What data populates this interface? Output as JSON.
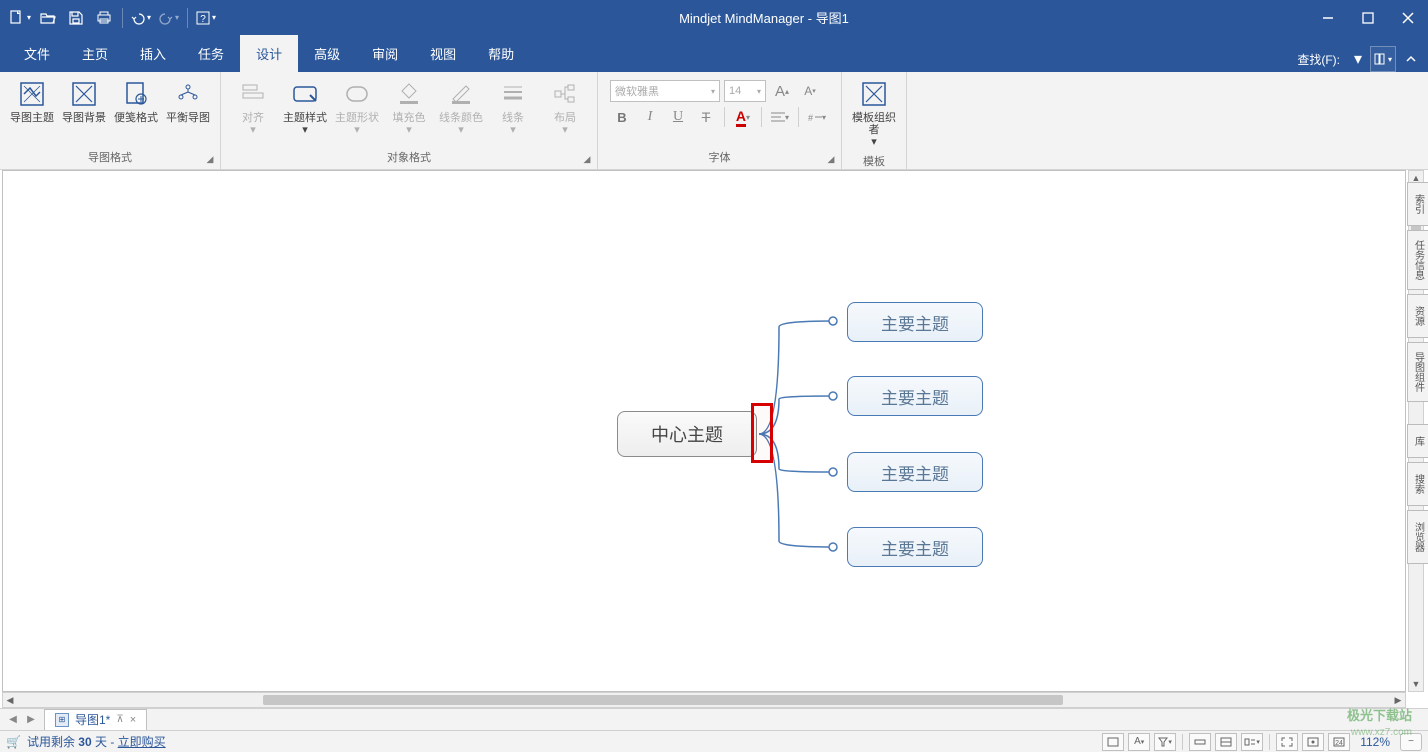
{
  "app": {
    "title": "Mindjet MindManager - 导图1"
  },
  "qat": {
    "dropdown_caret": "▾"
  },
  "menu": {
    "tabs": [
      "文件",
      "主页",
      "插入",
      "任务",
      "设计",
      "高级",
      "审阅",
      "视图",
      "帮助"
    ],
    "active_index": 4,
    "find_label": "查找(F):"
  },
  "ribbon": {
    "g1": {
      "label": "导图格式",
      "items": [
        "导图主题",
        "导图背景",
        "便笺格式",
        "平衡导图"
      ]
    },
    "g2": {
      "label": "对象格式",
      "items": [
        "对齐",
        "主题样式",
        "主题形状",
        "填充色",
        "线条颜色",
        "线条",
        "布局"
      ]
    },
    "g3": {
      "label": "字体",
      "font_name": "微软雅黑",
      "font_size": "14",
      "btns": {
        "b": "B",
        "i": "I",
        "u": "U",
        "strike": "₮",
        "fc": "A",
        "align": "≡",
        "num": "#"
      },
      "inc": "A",
      "dec": "A"
    },
    "g4": {
      "label": "模板",
      "item": "模板组织者"
    }
  },
  "mindmap": {
    "central": "中心主题",
    "subtopics": [
      "主要主题",
      "主要主题",
      "主要主题",
      "主要主题"
    ]
  },
  "side_tabs": [
    "索引",
    "任务信息",
    "资源",
    "导图组件",
    "库",
    "搜索",
    "浏览器"
  ],
  "doctab": {
    "name": "导图1*",
    "pin": "📌",
    "close": "×"
  },
  "status": {
    "trial_prefix": "试用剩余 ",
    "trial_days": "30",
    "trial_suffix": " 天 - ",
    "buy": "立即购买",
    "zoom": "112%"
  },
  "watermark": {
    "l1": "极光下载站",
    "l2": "www.xz7.com"
  }
}
